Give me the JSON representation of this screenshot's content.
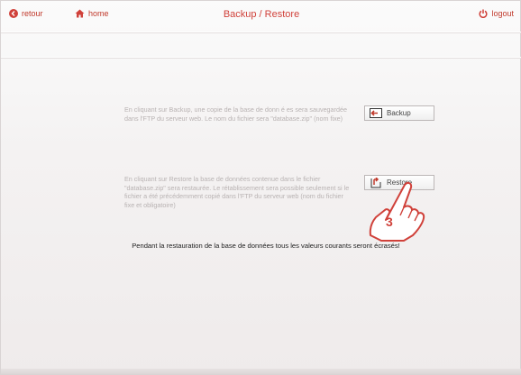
{
  "header": {
    "back_label": "retour",
    "home_label": "home",
    "title": "Backup / Restore",
    "logout_label": "logout"
  },
  "backup": {
    "description": "En cliquant sur Backup, une copie de la base de donn é es sera sauvegardée dans l'FTP du serveur web. Le nom du fichier sera \"database.zip\" (nom fixe)",
    "button_label": "Backup"
  },
  "restore": {
    "description": "En cliquant sur Restore la base de données contenue dans le fichier \"database.zip\" sera restaurée. Le rétablissement sera possible seulement si le fichier a été précédemment copié dans l'FTP du serveur web (nom du fichier fixe et obligatoire)",
    "button_label": "Restore"
  },
  "warning": "Pendant la restauration de la base de données tous les valeurs courants seront écrasés!",
  "step_marker": "3",
  "colors": {
    "accent": "#d0413a",
    "text_muted": "#b8b2b2"
  }
}
